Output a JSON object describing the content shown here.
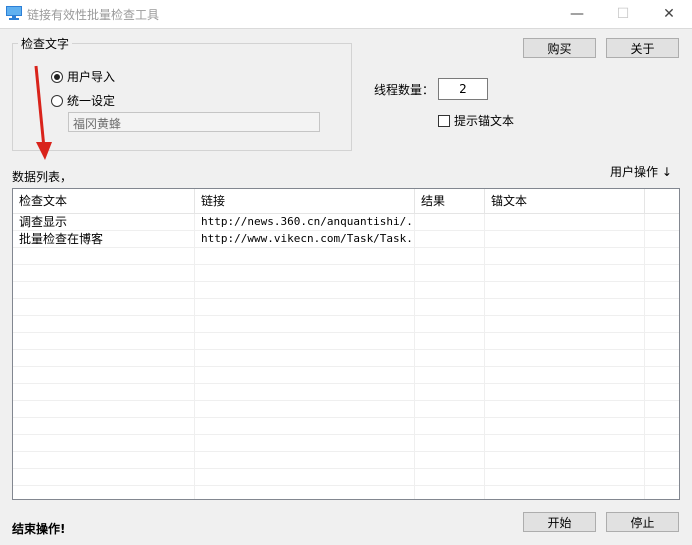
{
  "window": {
    "title": "链接有效性批量检查工具",
    "minimize": "—",
    "maximize": "☐",
    "close": "✕"
  },
  "check_group": {
    "label": "检查文字",
    "options": [
      {
        "label": "用户导入",
        "checked": true
      },
      {
        "label": "统一设定",
        "checked": false
      }
    ],
    "unified_value": "福冈黄蜂"
  },
  "buttons": {
    "buy": "购买",
    "about": "关于",
    "start": "开始",
    "stop": "停止"
  },
  "threads": {
    "label": "线程数量：",
    "value": "2"
  },
  "anchor_hint": {
    "label": "提示锚文本",
    "checked": false
  },
  "list": {
    "label": "数据列表，",
    "user_op": "用户操作 ↓",
    "columns": [
      "检查文本",
      "链接",
      "结果",
      "锚文本",
      ""
    ],
    "rows": [
      [
        "调查显示",
        "http://news.360.cn/anquantishi/...",
        "",
        "",
        ""
      ],
      [
        "批量检查在博客",
        "http://www.vikecn.com/Task/Task...",
        "",
        "",
        ""
      ]
    ]
  },
  "status": {
    "end_label": "结束操作!"
  },
  "annotation": {
    "arrow_color": "#d9231b"
  }
}
